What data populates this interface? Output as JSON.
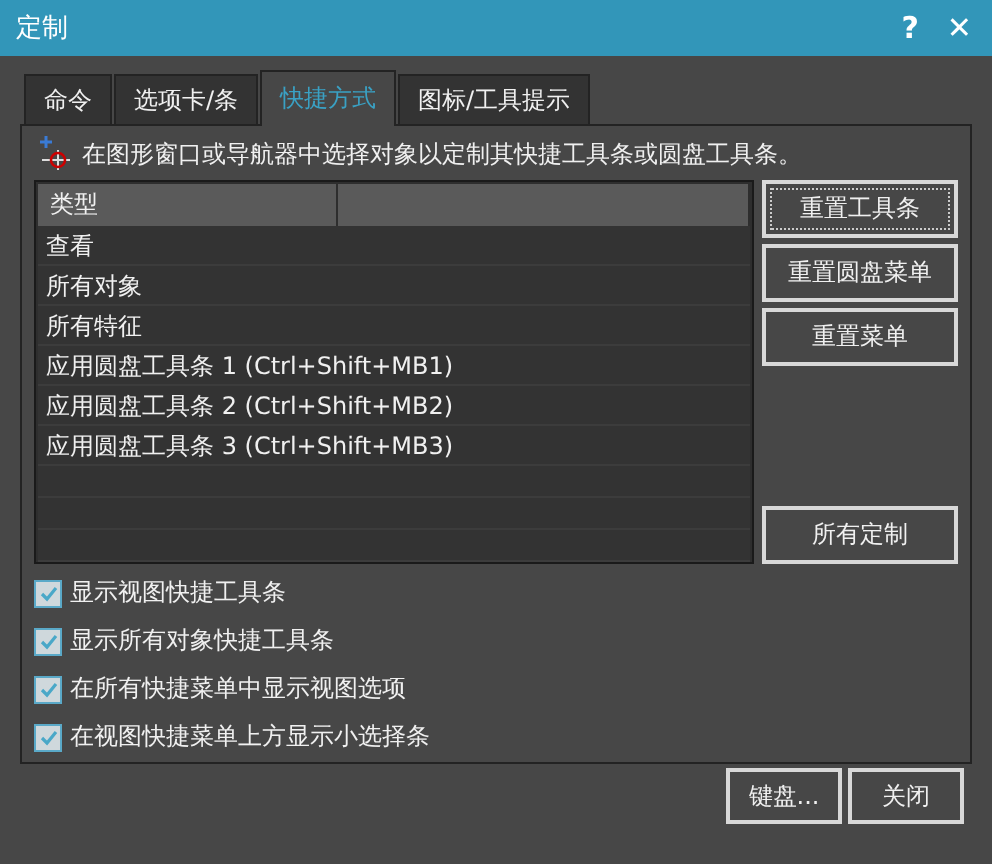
{
  "window": {
    "title": "定制",
    "help": "?",
    "close": "✕"
  },
  "tabs": [
    {
      "label": "命令",
      "selected": false
    },
    {
      "label": "选项卡/条",
      "selected": false
    },
    {
      "label": "快捷方式",
      "selected": true
    },
    {
      "label": "图标/工具提示",
      "selected": false
    }
  ],
  "instruction": "在图形窗口或导航器中选择对象以定制其快捷工具条或圆盘工具条。",
  "table": {
    "columns": [
      "类型"
    ],
    "rows": [
      "查看",
      "所有对象",
      "所有特征",
      "应用圆盘工具条 1 (Ctrl+Shift+MB1)",
      "应用圆盘工具条 2 (Ctrl+Shift+MB2)",
      "应用圆盘工具条 3 (Ctrl+Shift+MB3)"
    ]
  },
  "side_buttons": [
    {
      "label": "重置工具条",
      "focused": true
    },
    {
      "label": "重置圆盘菜单",
      "focused": false
    },
    {
      "label": "重置菜单",
      "focused": false
    }
  ],
  "all_button": "所有定制",
  "options": [
    {
      "label": "显示视图快捷工具条",
      "checked": true
    },
    {
      "label": "显示所有对象快捷工具条",
      "checked": true
    },
    {
      "label": "在所有快捷菜单中显示视图选项",
      "checked": true
    },
    {
      "label": "在视图快捷菜单上方显示小选择条",
      "checked": true
    }
  ],
  "buttons": [
    "键盘...",
    "关闭"
  ]
}
